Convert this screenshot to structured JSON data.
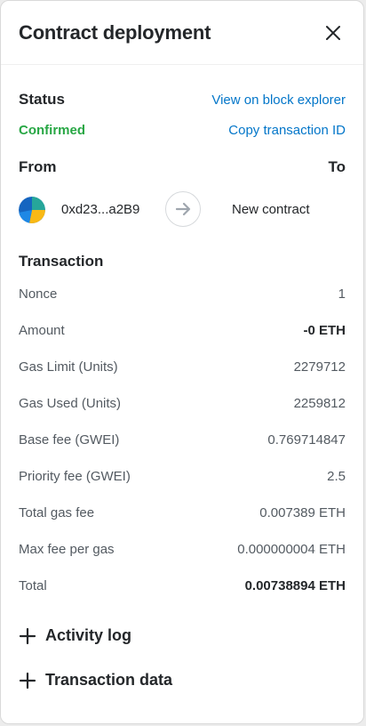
{
  "header": {
    "title": "Contract deployment"
  },
  "status": {
    "label": "Status",
    "value": "Confirmed",
    "explorer_link": "View on block explorer",
    "copy_link": "Copy transaction ID"
  },
  "parties": {
    "from_label": "From",
    "to_label": "To",
    "from_address": "0xd23...a2B9",
    "to_name": "New contract"
  },
  "transaction": {
    "label": "Transaction",
    "rows": [
      {
        "label": "Nonce",
        "value": "1",
        "bold": false
      },
      {
        "label": "Amount",
        "value": "-0 ETH",
        "bold": true
      },
      {
        "label": "Gas Limit (Units)",
        "value": "2279712",
        "bold": false
      },
      {
        "label": "Gas Used (Units)",
        "value": "2259812",
        "bold": false
      },
      {
        "label": "Base fee (GWEI)",
        "value": "0.769714847",
        "bold": false
      },
      {
        "label": "Priority fee (GWEI)",
        "value": "2.5",
        "bold": false
      },
      {
        "label": "Total gas fee",
        "value": "0.007389 ETH",
        "bold": false
      },
      {
        "label": "Max fee per gas",
        "value": "0.000000004 ETH",
        "bold": false
      },
      {
        "label": "Total",
        "value": "0.00738894 ETH",
        "bold": true
      }
    ]
  },
  "expanders": {
    "activity_log": "Activity log",
    "transaction_data": "Transaction data"
  },
  "colors": {
    "link": "#0376c9",
    "confirmed": "#28a745",
    "text": "#24272a",
    "muted": "#535a61"
  }
}
